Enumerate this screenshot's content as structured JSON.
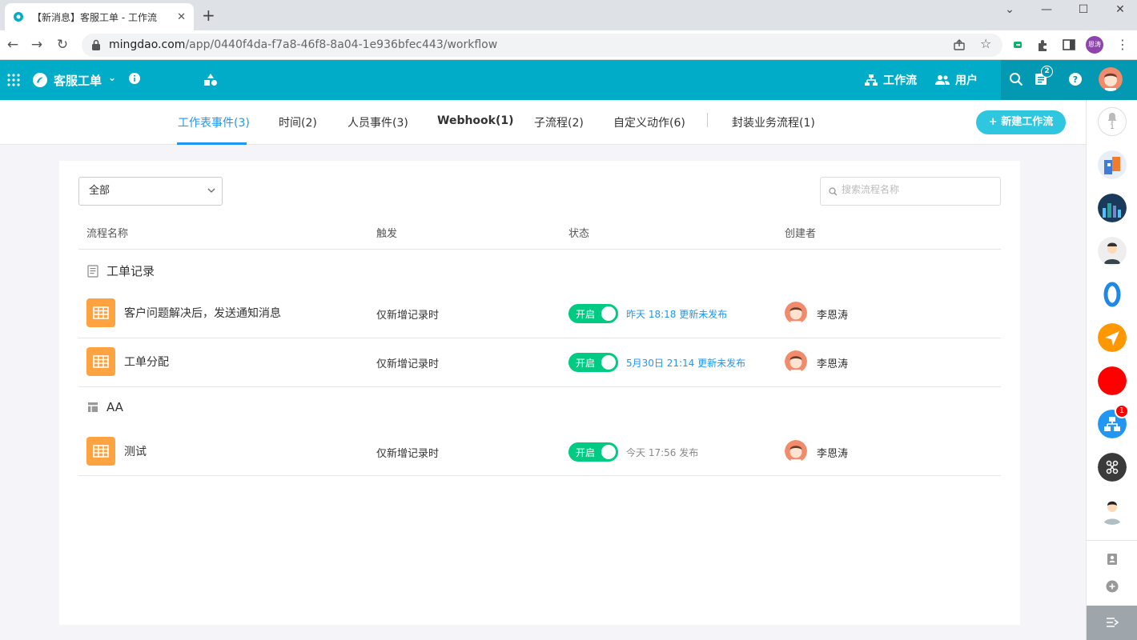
{
  "browser": {
    "tab_title": "【新消息】客服工单 - 工作流",
    "url_host": "mingdao.com",
    "url_path": "/app/0440f4da-f7a8-46f8-8a04-1e936bfec443/workflow",
    "profile_initials": "恩涛"
  },
  "header": {
    "app_name": "客服工单",
    "workflow_label": "工作流",
    "users_label": "用户",
    "notification_count": "2"
  },
  "tabs": [
    {
      "label": "工作表事件(3)",
      "active": true
    },
    {
      "label": "时间(2)"
    },
    {
      "label": "人员事件(3)"
    },
    {
      "label": "Webhook(1)"
    },
    {
      "label": "子流程(2)"
    },
    {
      "label": "自定义动作(6)"
    },
    {
      "label": "封装业务流程(1)"
    }
  ],
  "new_workflow_label": "+ 新建工作流",
  "filter": {
    "selected": "全部"
  },
  "search": {
    "placeholder": "搜索流程名称"
  },
  "columns": {
    "name": "流程名称",
    "trigger": "触发",
    "status": "状态",
    "creator": "创建者"
  },
  "groups": [
    {
      "title": "工单记录",
      "rows": [
        {
          "name": "客户问题解决后，发送通知消息",
          "trigger": "仅新增记录时",
          "toggle": "开启",
          "status": "昨天 18:18 更新未发布",
          "creator": "李恩涛"
        },
        {
          "name": "工单分配",
          "trigger": "仅新增记录时",
          "toggle": "开启",
          "status": "5月30日 21:14 更新未发布",
          "creator": "李恩涛"
        }
      ]
    },
    {
      "title": "AA",
      "rows": [
        {
          "name": "测试",
          "trigger": "仅新增记录时",
          "toggle": "开启",
          "status": "今天 17:56 发布",
          "creator": "李恩涛"
        }
      ]
    }
  ],
  "sidebar": {
    "bell_count": "1",
    "badge_count": "1"
  },
  "colors": {
    "header": "#00acc8",
    "accent": "#2196f3",
    "toggle_on": "#01ca83",
    "app_icon": "#ffa340"
  }
}
